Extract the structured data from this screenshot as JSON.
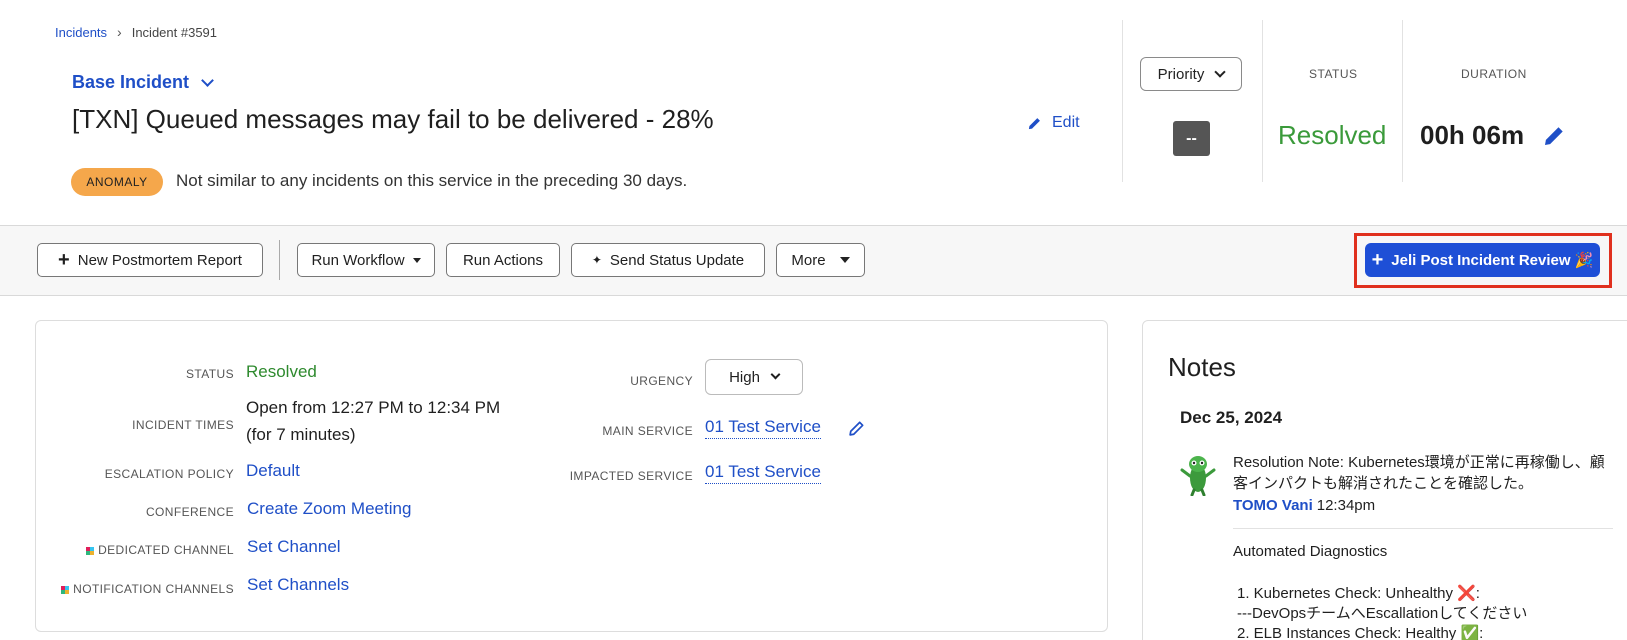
{
  "breadcrumb": {
    "parent": "Incidents",
    "separator": "›",
    "current": "Incident #3591"
  },
  "incident": {
    "type": "Base Incident",
    "title": "[TXN] Queued messages may fail to be delivered - 28%",
    "edit_label": "Edit",
    "anomaly_badge": "ANOMALY",
    "anomaly_text": "Not similar to any incidents on this service in the preceding 30 days."
  },
  "summary": {
    "priority_label": "Priority",
    "priority_value": "--",
    "status_label": "STATUS",
    "status_value": "Resolved",
    "duration_label": "DURATION",
    "duration_value": "00h 06m"
  },
  "toolbar": {
    "new_postmortem": "New Postmortem Report",
    "run_workflow": "Run Workflow",
    "run_actions": "Run Actions",
    "send_status_update": "Send Status Update",
    "more": "More",
    "jeli_review": "Jeli Post Incident Review 🎉"
  },
  "details": {
    "status_label": "STATUS",
    "status_value": "Resolved",
    "times_label": "INCIDENT TIMES",
    "times_line1": "Open from 12:27 PM to 12:34 PM",
    "times_line2": "(for 7 minutes)",
    "escalation_label": "ESCALATION POLICY",
    "escalation_value": "Default",
    "conference_label": "CONFERENCE",
    "conference_value": "Create Zoom Meeting",
    "dedicated_label": "DEDICATED CHANNEL",
    "dedicated_value": "Set Channel",
    "notification_label": "NOTIFICATION CHANNELS",
    "notification_value": "Set Channels",
    "urgency_label": "URGENCY",
    "urgency_value": "High",
    "main_service_label": "MAIN SERVICE",
    "main_service_value": "01 Test Service",
    "impacted_label": "IMPACTED SERVICE",
    "impacted_value": "01 Test Service"
  },
  "notes": {
    "title": "Notes",
    "date": "Dec 25, 2024",
    "note_text": "Resolution Note: Kubernetes環境が正常に再稼働し、顧客インパクトも解消されたことを確認した。",
    "author": "TOMO Vani",
    "time": "12:34pm",
    "diag_title": "Automated Diagnostics",
    "diag_line1": "1. Kubernetes Check: Unhealthy ❌:",
    "diag_line2": "---DevOpsチームへEscallationしてください",
    "diag_line3": "2. ELB Instances Check: Healthy ✅:"
  },
  "colors": {
    "accent": "#1f4fc7",
    "primary_button": "#1e4fd6",
    "resolved": "#3a9a3a",
    "anomaly": "#f5a74b",
    "highlight": "#e0301e"
  }
}
